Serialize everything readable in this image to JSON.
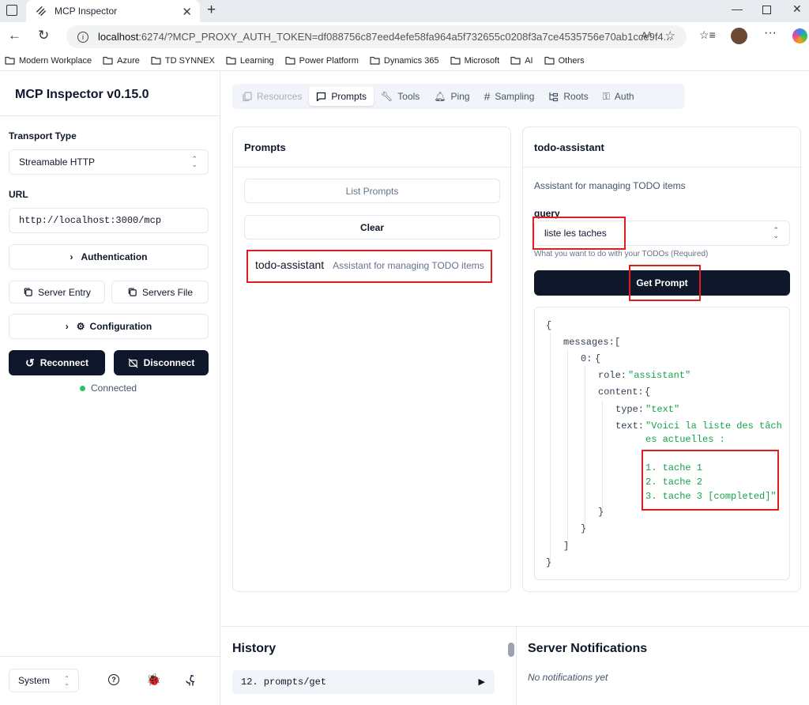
{
  "browser": {
    "tab_title": "MCP Inspector",
    "url_host": "localhost",
    "url_rest": ":6274/?MCP_PROXY_AUTH_TOKEN=df088756c87eed4efe58fa964a5f732655c0208f3a7ce4535756e70ab1cce9f4...",
    "favorites": [
      "Modern Workplace",
      "Azure",
      "TD SYNNEX",
      "Learning",
      "Power Platform",
      "Dynamics 365",
      "Microsoft",
      "AI",
      "Others"
    ]
  },
  "sidebar": {
    "title": "MCP Inspector v0.15.0",
    "transport_label": "Transport Type",
    "transport_value": "Streamable HTTP",
    "url_label": "URL",
    "url_value": "http://localhost:3000/mcp",
    "authentication": "Authentication",
    "server_entry": "Server Entry",
    "servers_file": "Servers File",
    "configuration": "Configuration",
    "reconnect": "Reconnect",
    "disconnect": "Disconnect",
    "status": "Connected",
    "status_color": "#22c55e",
    "theme": "System"
  },
  "tabs": [
    "Resources",
    "Prompts",
    "Tools",
    "Ping",
    "Sampling",
    "Roots",
    "Auth"
  ],
  "prompts_panel": {
    "title": "Prompts",
    "list_button": "List Prompts",
    "clear_button": "Clear",
    "item_name": "todo-assistant",
    "item_desc": "Assistant for managing TODO items"
  },
  "detail_panel": {
    "title": "todo-assistant",
    "description": "Assistant for managing TODO items",
    "arg_label": "query",
    "arg_value": "liste les taches",
    "arg_hint": "What you want to do with your TODOs (Required)",
    "get_button": "Get Prompt"
  },
  "json": {
    "open": "{",
    "messages_key": "messages:",
    "bracket_open": "[",
    "idx_key": "0:",
    "brace_open": "{",
    "role_key": "role:",
    "role_val": "\"assistant\"",
    "content_key": "content:",
    "type_key": "type:",
    "type_val": "\"text\"",
    "text_key": "text:",
    "text_l1": "\"Voici la liste des tâch",
    "text_l2": "es actuelles :",
    "text_l3": "1. tache 1",
    "text_l4": "2. tache 2",
    "text_l5": "3. tache 3 [completed]\"",
    "brace_close": "}",
    "bracket_close": "]",
    "close": "}"
  },
  "history": {
    "title": "History",
    "item": "12. prompts/get"
  },
  "notifications": {
    "title": "Server Notifications",
    "empty": "No notifications yet"
  },
  "colors": {
    "highlight": "#e11d1d",
    "primary": "#0f172a",
    "json_string": "#16a34a"
  }
}
